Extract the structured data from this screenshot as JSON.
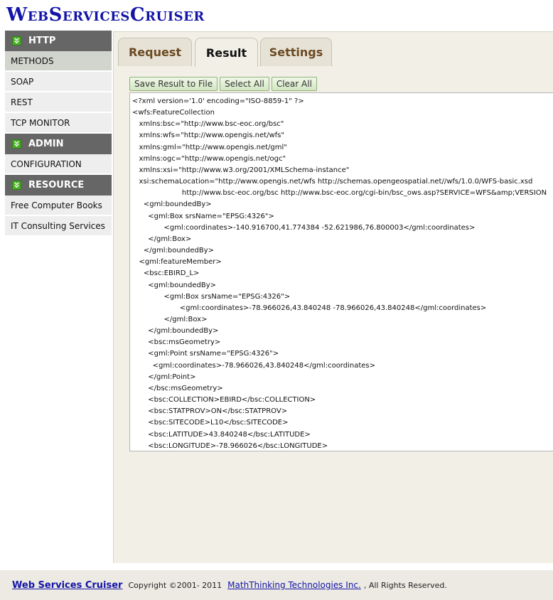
{
  "app": {
    "logo": "WebServicesCruiser"
  },
  "sidebar": {
    "sections": [
      {
        "title": "HTTP",
        "icon": "arrow-down-icon",
        "items": [
          "METHODS",
          "SOAP",
          "REST",
          "TCP MONITOR"
        ]
      },
      {
        "title": "ADMIN",
        "icon": "arrow-down-icon",
        "items": [
          "CONFIGURATION"
        ]
      },
      {
        "title": "RESOURCE",
        "icon": "arrow-down-icon",
        "items": [
          "Free Computer Books",
          "IT Consulting Services"
        ]
      }
    ],
    "active_item": "METHODS"
  },
  "tabs": [
    {
      "label": "Request"
    },
    {
      "label": "Result"
    },
    {
      "label": "Settings"
    }
  ],
  "active_tab": "Result",
  "toolbar": {
    "save_label": "Save Result to File",
    "select_all_label": "Select All",
    "clear_all_label": "Clear All"
  },
  "result": {
    "xml": "<?xml version='1.0' encoding=\"ISO-8859-1\" ?>\n<wfs:FeatureCollection\n   xmlns:bsc=\"http://www.bsc-eoc.org/bsc\"\n   xmlns:wfs=\"http://www.opengis.net/wfs\"\n   xmlns:gml=\"http://www.opengis.net/gml\"\n   xmlns:ogc=\"http://www.opengis.net/ogc\"\n   xmlns:xsi=\"http://www.w3.org/2001/XMLSchema-instance\"\n   xsi:schemaLocation=\"http://www.opengis.net/wfs http://schemas.opengeospatial.net//wfs/1.0.0/WFS-basic.xsd\n                      http://www.bsc-eoc.org/bsc http://www.bsc-eoc.org/cgi-bin/bsc_ows.asp?SERVICE=WFS&amp;VERSION\n     <gml:boundedBy>\n       <gml:Box srsName=\"EPSG:4326\">\n              <gml:coordinates>-140.916700,41.774384 -52.621986,76.800003</gml:coordinates>\n       </gml:Box>\n     </gml:boundedBy>\n   <gml:featureMember>\n     <bsc:EBIRD_L>\n       <gml:boundedBy>\n              <gml:Box srsName=\"EPSG:4326\">\n                     <gml:coordinates>-78.966026,43.840248 -78.966026,43.840248</gml:coordinates>\n              </gml:Box>\n       </gml:boundedBy>\n       <bsc:msGeometry>\n       <gml:Point srsName=\"EPSG:4326\">\n         <gml:coordinates>-78.966026,43.840248</gml:coordinates>\n       </gml:Point>\n       </bsc:msGeometry>\n       <bsc:COLLECTION>EBIRD</bsc:COLLECTION>\n       <bsc:STATPROV>ON</bsc:STATPROV>\n       <bsc:SITECODE>L10</bsc:SITECODE>\n       <bsc:LATITUDE>43.840248</bsc:LATITUDE>\n       <bsc:LONGITUDE>-78.966026</bsc:LONGITUDE>\n     </bsc:EBIRD_L>"
  },
  "footer": {
    "brand": "Web Services Cruiser",
    "copyright": "Copyright ©2001- 2011",
    "company": "MathThinking Technologies Inc.",
    "rights": ", All Rights Reserved."
  },
  "colors": {
    "logo": "#1414a8",
    "section_header": "#666666",
    "panel": "#f2efe6",
    "button_border": "#8fb47a"
  }
}
